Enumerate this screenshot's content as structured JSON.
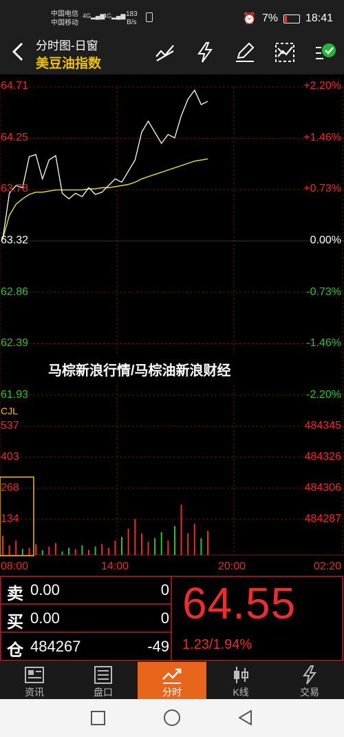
{
  "status_bar": {
    "carrier1": "中国电信",
    "carrier2": "中国移动",
    "net1": "4G",
    "net2": "4G",
    "speed_value": "183",
    "speed_unit": "B/s",
    "battery": "7%",
    "time": "18:41"
  },
  "header": {
    "title": "分时图-日窗",
    "subtitle": "美豆油指数",
    "icons": [
      "draw-line-icon",
      "lightning-icon",
      "pen-icon",
      "checklist-icon",
      "check-circle-icon"
    ]
  },
  "colors": {
    "up": "#ea2d2d",
    "down": "#2ec52e",
    "avg_line": "#d8d830",
    "accent": "#e7661c",
    "title": "#f2c200"
  },
  "chart_data": {
    "type": "line",
    "price_axis_left": [
      "64.71",
      "64.25",
      "63.78",
      "63.32",
      "62.86",
      "62.39",
      "61.93"
    ],
    "price_axis_right": [
      "+2.20%",
      "+1.46%",
      "+0.73%",
      "0.00%",
      "-0.73%",
      "-1.46%",
      "-2.20%"
    ],
    "ylim": [
      61.93,
      64.71
    ],
    "baseline": 63.32,
    "volume_label": "CJL",
    "volume_axis_left": [
      "537",
      "403",
      "268",
      "134"
    ],
    "open_interest_axis_right": [
      "484345",
      "484326",
      "484306",
      "484287"
    ],
    "time_axis": [
      "08:00",
      "14:00",
      "20:00",
      "02:20"
    ],
    "price_series": [
      63.34,
      63.75,
      63.82,
      63.8,
      64.08,
      64.1,
      63.88,
      64.05,
      64.09,
      63.75,
      63.7,
      63.75,
      63.72,
      63.8,
      63.74,
      63.76,
      63.82,
      63.88,
      63.85,
      63.95,
      64.05,
      64.3,
      64.4,
      64.3,
      64.2,
      64.28,
      64.25,
      64.45,
      64.6,
      64.68,
      64.55,
      64.58
    ],
    "avg_series": [
      63.34,
      63.55,
      63.65,
      63.7,
      63.74,
      63.76,
      63.76,
      63.77,
      63.78,
      63.78,
      63.78,
      63.78,
      63.78,
      63.79,
      63.79,
      63.8,
      63.8,
      63.81,
      63.82,
      63.83,
      63.85,
      63.88,
      63.9,
      63.92,
      63.94,
      63.96,
      63.98,
      64.0,
      64.02,
      64.04,
      64.05,
      64.06
    ],
    "volume_series": [
      80,
      40,
      60,
      25,
      30,
      45,
      20,
      35,
      50,
      15,
      30,
      25,
      40,
      20,
      35,
      45,
      30,
      60,
      75,
      110,
      150,
      90,
      55,
      70,
      95,
      60,
      120,
      210,
      90,
      130,
      70,
      100
    ]
  },
  "overlay_text": "马棕新浪行情/马棕油新浪财经",
  "quote": {
    "sell_label": "卖",
    "sell_price": "0.00",
    "sell_qty": "0",
    "buy_label": "买",
    "buy_price": "0.00",
    "buy_qty": "0",
    "oi_label": "仓",
    "oi_value": "484267",
    "oi_change": "-49",
    "last_price": "64.55",
    "change": "1.23/1.94%"
  },
  "tabs": [
    {
      "label": "资讯",
      "icon": "news-icon"
    },
    {
      "label": "盘口",
      "icon": "orderbook-icon"
    },
    {
      "label": "分时",
      "icon": "timeshare-icon"
    },
    {
      "label": "K线",
      "icon": "kline-icon"
    },
    {
      "label": "交易",
      "icon": "trade-icon"
    }
  ],
  "nav": [
    "recent-apps-icon",
    "home-icon",
    "back-icon"
  ]
}
